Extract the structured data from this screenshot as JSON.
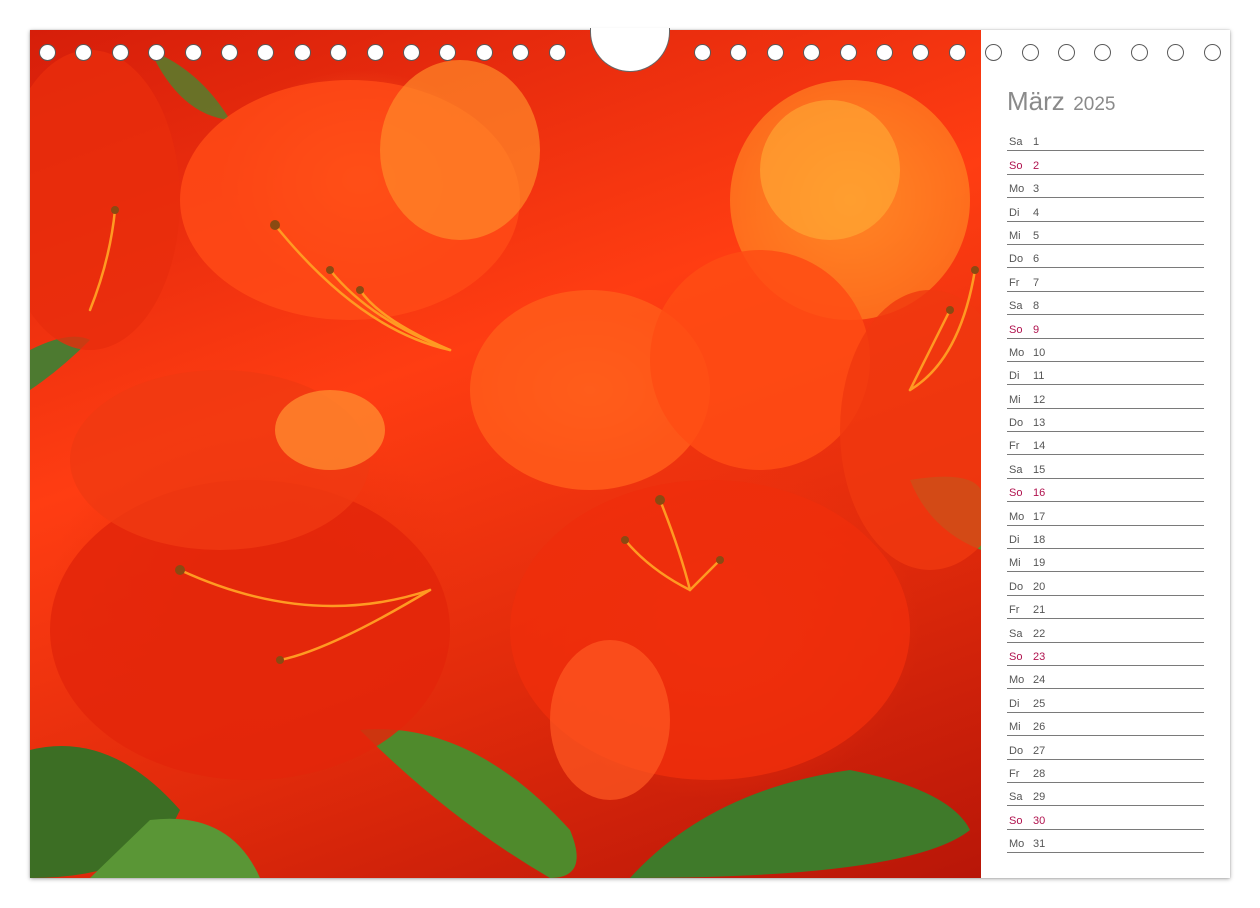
{
  "calendar": {
    "month": "März",
    "year": "2025",
    "days": [
      {
        "wd": "Sa",
        "d": "1",
        "sunday": false
      },
      {
        "wd": "So",
        "d": "2",
        "sunday": true
      },
      {
        "wd": "Mo",
        "d": "3",
        "sunday": false
      },
      {
        "wd": "Di",
        "d": "4",
        "sunday": false
      },
      {
        "wd": "Mi",
        "d": "5",
        "sunday": false
      },
      {
        "wd": "Do",
        "d": "6",
        "sunday": false
      },
      {
        "wd": "Fr",
        "d": "7",
        "sunday": false
      },
      {
        "wd": "Sa",
        "d": "8",
        "sunday": false
      },
      {
        "wd": "So",
        "d": "9",
        "sunday": true
      },
      {
        "wd": "Mo",
        "d": "10",
        "sunday": false
      },
      {
        "wd": "Di",
        "d": "11",
        "sunday": false
      },
      {
        "wd": "Mi",
        "d": "12",
        "sunday": false
      },
      {
        "wd": "Do",
        "d": "13",
        "sunday": false
      },
      {
        "wd": "Fr",
        "d": "14",
        "sunday": false
      },
      {
        "wd": "Sa",
        "d": "15",
        "sunday": false
      },
      {
        "wd": "So",
        "d": "16",
        "sunday": true
      },
      {
        "wd": "Mo",
        "d": "17",
        "sunday": false
      },
      {
        "wd": "Di",
        "d": "18",
        "sunday": false
      },
      {
        "wd": "Mi",
        "d": "19",
        "sunday": false
      },
      {
        "wd": "Do",
        "d": "20",
        "sunday": false
      },
      {
        "wd": "Fr",
        "d": "21",
        "sunday": false
      },
      {
        "wd": "Sa",
        "d": "22",
        "sunday": false
      },
      {
        "wd": "So",
        "d": "23",
        "sunday": true
      },
      {
        "wd": "Mo",
        "d": "24",
        "sunday": false
      },
      {
        "wd": "Di",
        "d": "25",
        "sunday": false
      },
      {
        "wd": "Mi",
        "d": "26",
        "sunday": false
      },
      {
        "wd": "Do",
        "d": "27",
        "sunday": false
      },
      {
        "wd": "Fr",
        "d": "28",
        "sunday": false
      },
      {
        "wd": "Sa",
        "d": "29",
        "sunday": false
      },
      {
        "wd": "So",
        "d": "30",
        "sunday": true
      },
      {
        "wd": "Mo",
        "d": "31",
        "sunday": false
      }
    ]
  },
  "photo": {
    "subject": "red-orange azalea blossoms"
  },
  "colors": {
    "sunday": "#b0124e",
    "text": "#555555",
    "title": "#8a8a8a",
    "rule": "#7a7a7a"
  }
}
